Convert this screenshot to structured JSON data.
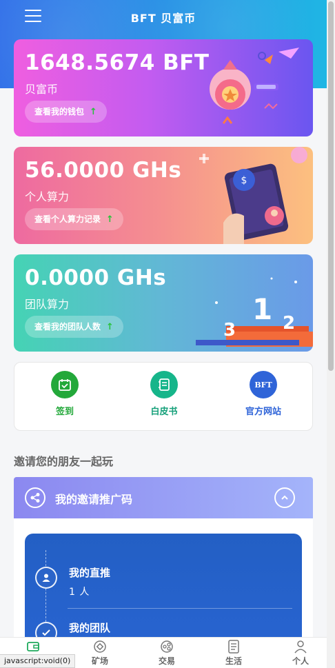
{
  "header": {
    "title": "BFT 贝富币"
  },
  "cards": [
    {
      "amount": "1648.5674 BFT",
      "label": "贝富币",
      "button": "查看我的钱包",
      "arrow": "↑"
    },
    {
      "amount": "56.0000 GHs",
      "label": "个人算力",
      "button": "查看个人算力记录",
      "arrow": "↑"
    },
    {
      "amount": "0.0000 GHs",
      "label": "团队算力",
      "button": "查看我的团队人数",
      "arrow": "↑"
    }
  ],
  "quick_links": [
    {
      "label": "签到",
      "color": "#23a83a",
      "icon": "calendar-check-icon"
    },
    {
      "label": "白皮书",
      "color": "#16b58a",
      "icon": "notebook-icon"
    },
    {
      "label": "官方网站",
      "color": "#2f64d8",
      "icon": "bft-logo-icon",
      "icon_text": "BFT"
    }
  ],
  "invite": {
    "section_title": "邀请您的朋友一起玩",
    "header": "我的邀请推广码"
  },
  "team": {
    "rows": [
      {
        "title": "我的直推",
        "value": "1 人"
      },
      {
        "title": "我的团队",
        "value": ""
      }
    ]
  },
  "tabbar": {
    "items": [
      {
        "label": "",
        "icon": "wallet-icon"
      },
      {
        "label": "矿场",
        "icon": "mine-icon"
      },
      {
        "label": "交易",
        "icon": "exchange-icon"
      },
      {
        "label": "生活",
        "icon": "document-icon"
      },
      {
        "label": "个人",
        "icon": "person-icon"
      }
    ]
  },
  "status_bar": {
    "text": "javascript:void(0)"
  },
  "colors": {
    "accent": "#2b8fe6",
    "green_arrow": "#27c23a"
  }
}
